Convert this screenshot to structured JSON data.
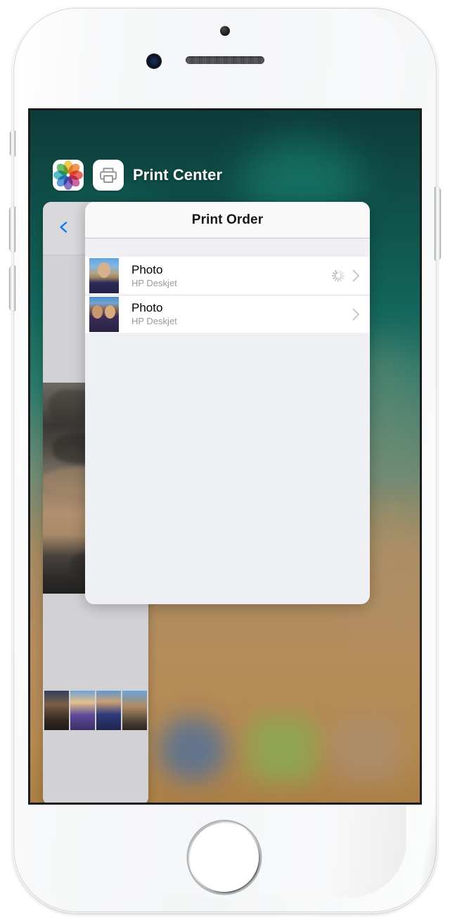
{
  "device": {
    "name": "iPhone",
    "hardware": {
      "sensor": "proximity-sensor",
      "camera": "front-camera",
      "speaker": "earpiece-speaker",
      "home_button": "home-button",
      "mute_switch": "mute-switch",
      "volume_up": "volume-up-button",
      "volume_down": "volume-down-button",
      "power": "power-button"
    }
  },
  "app_switcher": {
    "apps": [
      {
        "name": "Photos",
        "icon": "photos-icon",
        "label": ""
      },
      {
        "name": "Print Center",
        "icon": "printer-icon",
        "label": "Print Center"
      }
    ],
    "active_app_label": "Print Center"
  },
  "background_card": {
    "app": "Photos",
    "back_icon": "back-chevron-icon"
  },
  "print_center": {
    "nav": {
      "title": "Print Order"
    },
    "jobs": [
      {
        "title": "Photo",
        "subtitle": "HP Deskjet",
        "thumbnail": "photo-thumbnail-1",
        "status": "printing",
        "spinner": true,
        "disclosure": "chevron-right-icon"
      },
      {
        "title": "Photo",
        "subtitle": "HP Deskjet",
        "thumbnail": "photo-thumbnail-2",
        "status": "queued",
        "spinner": false,
        "disclosure": "chevron-right-icon"
      }
    ]
  },
  "colors": {
    "nav_bar": "#f8f8f9",
    "card_body": "#eff0f4",
    "row_bg": "#ffffff",
    "title_text": "#000000",
    "subtitle_text": "#9a9a9f",
    "separator": "#dedee1",
    "tint_blue": "#007aff",
    "wallpaper_top": "#0d3b39",
    "wallpaper_bottom": "#ab7f47",
    "spinner": "#b6b6ba",
    "chevron": "#c7c7cc"
  },
  "photos_icon_petals": [
    "#f2c53d",
    "#f08a3c",
    "#e5554f",
    "#c8509b",
    "#7d5fc0",
    "#4a8fd8",
    "#3fb6c8",
    "#5cb85c"
  ]
}
